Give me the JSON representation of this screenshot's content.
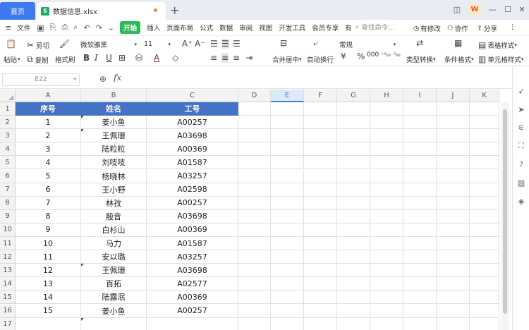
{
  "titlebar": {
    "home_tab": "首页",
    "file_tab": "数据信息.xlsx",
    "file_icon": "S",
    "new_tab": "+"
  },
  "menubar": {
    "file": "文件",
    "start": "开始",
    "items": [
      "插入",
      "页面布局",
      "公式",
      "数据",
      "审阅",
      "视图",
      "开发工具",
      "会员专享",
      "有"
    ],
    "search_placeholder": "查找命令...",
    "right": [
      "有修改",
      "协作",
      "分享"
    ]
  },
  "ribbon": {
    "paste": "粘贴",
    "cut": "剪切",
    "copy": "复制",
    "format_painter": "格式刷",
    "font_name": "微软雅黑",
    "font_size": "11",
    "merge_center": "合并居中",
    "wrap_text": "自动换行",
    "number_format": "常规",
    "type_convert": "类型转换",
    "cond_format": "条件格式",
    "table_style": "表格样式",
    "cell_style": "单元格样式"
  },
  "formulabar": {
    "name_box": "E22",
    "fx": "fx"
  },
  "sheet": {
    "columns": [
      "A",
      "B",
      "C",
      "D",
      "E",
      "F",
      "G",
      "H",
      "I",
      "J",
      "K"
    ],
    "active_column": "E",
    "header": [
      "序号",
      "姓名",
      "工号"
    ],
    "rows": [
      [
        "1",
        "姜小鱼",
        "A00257"
      ],
      [
        "2",
        "王佩珊",
        "A03698"
      ],
      [
        "3",
        "陆粒粒",
        "A00369"
      ],
      [
        "4",
        "刘吱吱",
        "A01587"
      ],
      [
        "5",
        "杨晓林",
        "A03257"
      ],
      [
        "6",
        "王小野",
        "A02598"
      ],
      [
        "7",
        "林孜",
        "A00257"
      ],
      [
        "8",
        "殷音",
        "A03698"
      ],
      [
        "9",
        "白杉山",
        "A00369"
      ],
      [
        "10",
        "马力",
        "A01587"
      ],
      [
        "11",
        "安以璐",
        "A03257"
      ],
      [
        "12",
        "王佩珊",
        "A03698"
      ],
      [
        "13",
        "百拓",
        "A02577"
      ],
      [
        "14",
        "陆露泯",
        "A00369"
      ],
      [
        "15",
        "姜小鱼",
        "A00257"
      ]
    ],
    "flagged_rows": [
      1,
      2,
      12,
      16
    ]
  },
  "colors": {
    "header_fill": "#4472c4",
    "accent": "#3d7af2",
    "start_green": "#2fba5a"
  }
}
